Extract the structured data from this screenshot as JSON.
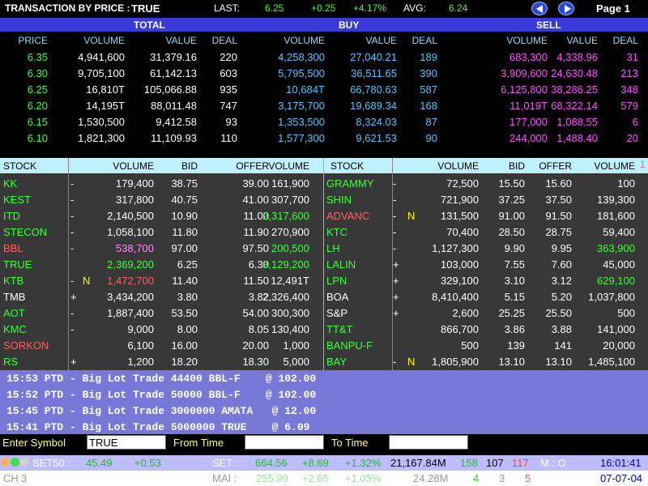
{
  "colors": {
    "green": "#3cff3c",
    "yellow": "#ffff00",
    "white": "#ffffff",
    "cyan": "#50c8ff",
    "magenta": "#ff50ff",
    "red": "#ff6060",
    "pink": "#ff88ff",
    "dimgreen": "#40ff40"
  },
  "top": {
    "title": "TRANSACTION BY PRICE :",
    "symbol": "TRUE",
    "last_label": "LAST:",
    "last": "6.25",
    "change": "+0.25",
    "pct": "+4.17%",
    "avg_label": "AVG:",
    "avg": "6.24",
    "page": "Page 1",
    "prev_icon": "arrow-left-icon",
    "next_icon": "arrow-right-icon"
  },
  "groups": {
    "total": "TOTAL",
    "buy": "BUY",
    "sell": "SELL"
  },
  "price_headers": [
    "PRICE",
    "VOLUME",
    "VALUE",
    "DEAL",
    "VOLUME",
    "VALUE",
    "DEAL",
    "VOLUME",
    "VALUE",
    "DEAL"
  ],
  "price_rows": [
    {
      "price": "6.35",
      "t_vol": "4,941,600",
      "t_val": "31,379.16",
      "t_deal": "220",
      "b_vol": "4,258,300",
      "b_val": "27,040.21",
      "b_deal": "189",
      "s_vol": "683,300",
      "s_val": "4,338.96",
      "s_deal": "31"
    },
    {
      "price": "6.30",
      "t_vol": "9,705,100",
      "t_val": "61,142.13",
      "t_deal": "603",
      "b_vol": "5,795,500",
      "b_val": "36,511.65",
      "b_deal": "390",
      "s_vol": "3,909,600",
      "s_val": "24,630.48",
      "s_deal": "213"
    },
    {
      "price": "6.25",
      "t_vol": "16,810T",
      "t_val": "105,066.88",
      "t_deal": "935",
      "b_vol": "10,684T",
      "b_val": "66,780.63",
      "b_deal": "587",
      "s_vol": "6,125,800",
      "s_val": "38,286.25",
      "s_deal": "348"
    },
    {
      "price": "6.20",
      "t_vol": "14,195T",
      "t_val": "88,011.48",
      "t_deal": "747",
      "b_vol": "3,175,700",
      "b_val": "19,689.34",
      "b_deal": "168",
      "s_vol": "11,019T",
      "s_val": "68,322.14",
      "s_deal": "579"
    },
    {
      "price": "6.15",
      "t_vol": "1,530,500",
      "t_val": "9,412.58",
      "t_deal": "93",
      "b_vol": "1,353,500",
      "b_val": "8,324.03",
      "b_deal": "87",
      "s_vol": "177,000",
      "s_val": "1,088.55",
      "s_deal": "6"
    },
    {
      "price": "6.10",
      "t_vol": "1,821,300",
      "t_val": "11,109.93",
      "t_deal": "110",
      "b_vol": "1,577,300",
      "b_val": "9,621.53",
      "b_deal": "90",
      "s_vol": "244,000",
      "s_val": "1,488.40",
      "s_deal": "20"
    }
  ],
  "stock_headers": [
    "STOCK",
    "VOLUME",
    "BID",
    "OFFER",
    "VOLUME",
    "STOCK",
    "VOLUME",
    "BID",
    "OFFER",
    "VOLUME"
  ],
  "stock_marker": "1",
  "stocks_left": [
    {
      "sym": "KK",
      "sym_color": "green",
      "sign": "-",
      "flag": "",
      "vol": "179,400",
      "vol_color": "white",
      "bid": "38.75",
      "offer": "39.00",
      "ovol": "161,900",
      "ovol_color": "white"
    },
    {
      "sym": "KEST",
      "sym_color": "green",
      "sign": "-",
      "flag": "",
      "vol": "317,800",
      "vol_color": "white",
      "bid": "40.75",
      "offer": "41.00",
      "ovol": "307,700",
      "ovol_color": "white"
    },
    {
      "sym": "ITD",
      "sym_color": "green",
      "sign": "-",
      "flag": "",
      "vol": "2,140,500",
      "vol_color": "white",
      "bid": "10.90",
      "offer": "11.00",
      "ovol": "2,317,600",
      "ovol_color": "green"
    },
    {
      "sym": "STECON",
      "sym_color": "green",
      "sign": "-",
      "flag": "",
      "vol": "1,058,100",
      "vol_color": "white",
      "bid": "11.80",
      "offer": "11.90",
      "ovol": "270,900",
      "ovol_color": "white"
    },
    {
      "sym": "BBL",
      "sym_color": "red",
      "sign": "-",
      "flag": "",
      "vol": "538,700",
      "vol_color": "pink",
      "bid": "97.00",
      "offer": "97.50",
      "ovol": "200,500",
      "ovol_color": "green"
    },
    {
      "sym": "TRUE",
      "sym_color": "green",
      "sign": "",
      "flag": "",
      "vol": "2,369,200",
      "vol_color": "green",
      "bid": "6.25",
      "offer": "6.30",
      "ovol": "3,129,200",
      "ovol_color": "green"
    },
    {
      "sym": "KTB",
      "sym_color": "green",
      "sign": "-",
      "flag": "N",
      "vol": "1,472,700",
      "vol_color": "red",
      "bid": "11.40",
      "offer": "11.50",
      "ovol": "12,491T",
      "ovol_color": "white"
    },
    {
      "sym": "TMB",
      "sym_color": "white",
      "sign": "+",
      "flag": "",
      "vol": "3,434,200",
      "vol_color": "white",
      "bid": "3.80",
      "offer": "3.82",
      "ovol": "2,326,400",
      "ovol_color": "white"
    },
    {
      "sym": "AOT",
      "sym_color": "green",
      "sign": "-",
      "flag": "",
      "vol": "1,887,400",
      "vol_color": "white",
      "bid": "53.50",
      "offer": "54.00",
      "ovol": "300,300",
      "ovol_color": "white"
    },
    {
      "sym": "KMC",
      "sym_color": "green",
      "sign": "-",
      "flag": "",
      "vol": "9,000",
      "vol_color": "white",
      "bid": "8.00",
      "offer": "8.05",
      "ovol": "130,400",
      "ovol_color": "white"
    },
    {
      "sym": "SORKON",
      "sym_color": "red",
      "sign": "",
      "flag": "",
      "vol": "6,100",
      "vol_color": "white",
      "bid": "16.00",
      "offer": "20.00",
      "ovol": "1,000",
      "ovol_color": "white"
    },
    {
      "sym": "RS",
      "sym_color": "green",
      "sign": "+",
      "flag": "",
      "vol": "1,200",
      "vol_color": "white",
      "bid": "18.20",
      "offer": "18.30",
      "ovol": "5,000",
      "ovol_color": "white"
    }
  ],
  "stocks_right": [
    {
      "sym": "GRAMMY",
      "sym_color": "green",
      "sign": "-",
      "flag": "",
      "vol": "72,500",
      "vol_color": "white",
      "bid": "15.50",
      "offer": "15.60",
      "ovol": "100",
      "ovol_color": "white"
    },
    {
      "sym": "SHIN",
      "sym_color": "green",
      "sign": "-",
      "flag": "",
      "vol": "721,900",
      "vol_color": "white",
      "bid": "37.25",
      "offer": "37.50",
      "ovol": "139,300",
      "ovol_color": "white"
    },
    {
      "sym": "ADVANC",
      "sym_color": "red",
      "sign": "-",
      "flag": "N",
      "vol": "131,500",
      "vol_color": "white",
      "bid": "91.00",
      "offer": "91.50",
      "ovol": "181,600",
      "ovol_color": "white"
    },
    {
      "sym": "KTC",
      "sym_color": "green",
      "sign": "-",
      "flag": "",
      "vol": "70,400",
      "vol_color": "white",
      "bid": "28.50",
      "offer": "28.75",
      "ovol": "59,400",
      "ovol_color": "white"
    },
    {
      "sym": "LH",
      "sym_color": "green",
      "sign": "-",
      "flag": "",
      "vol": "1,127,300",
      "vol_color": "white",
      "bid": "9.90",
      "offer": "9.95",
      "ovol": "363,900",
      "ovol_color": "green"
    },
    {
      "sym": "LALIN",
      "sym_color": "green",
      "sign": "+",
      "flag": "",
      "vol": "103,000",
      "vol_color": "white",
      "bid": "7.55",
      "offer": "7.60",
      "ovol": "45,000",
      "ovol_color": "white"
    },
    {
      "sym": "LPN",
      "sym_color": "green",
      "sign": "+",
      "flag": "",
      "vol": "329,100",
      "vol_color": "white",
      "bid": "3.10",
      "offer": "3.12",
      "ovol": "629,100",
      "ovol_color": "green"
    },
    {
      "sym": "BOA",
      "sym_color": "white",
      "sign": "+",
      "flag": "",
      "vol": "8,410,400",
      "vol_color": "white",
      "bid": "5.15",
      "offer": "5.20",
      "ovol": "1,037,800",
      "ovol_color": "white"
    },
    {
      "sym": "S&P",
      "sym_color": "white",
      "sign": "+",
      "flag": "",
      "vol": "2,600",
      "vol_color": "white",
      "bid": "25.25",
      "offer": "25.50",
      "ovol": "500",
      "ovol_color": "white"
    },
    {
      "sym": "TT&T",
      "sym_color": "green",
      "sign": "",
      "flag": "",
      "vol": "866,700",
      "vol_color": "white",
      "bid": "3.86",
      "offer": "3.88",
      "ovol": "141,000",
      "ovol_color": "white"
    },
    {
      "sym": "BANPU-F",
      "sym_color": "green",
      "sign": "",
      "flag": "",
      "vol": "500",
      "vol_color": "white",
      "bid": "139",
      "offer": "141",
      "ovol": "20,000",
      "ovol_color": "white"
    },
    {
      "sym": "BAY",
      "sym_color": "green",
      "sign": "-",
      "flag": "N",
      "vol": "1,805,900",
      "vol_color": "white",
      "bid": "13.10",
      "offer": "13.10",
      "ovol": "1,485,100",
      "ovol_color": "white"
    }
  ],
  "biglot": [
    "15:53 PTD - Big Lot Trade 44400 BBL-F    @ 102.00",
    "15:52 PTD - Big Lot Trade 50000 BBL-F    @ 102.00",
    "15:45 PTD - Big Lot Trade 3000000 AMATA   @ 12.00",
    "15:41 PTD - Big Lot Trade 5000000 TRUE    @ 6.09"
  ],
  "search": {
    "symbol_label": "Enter Symbol",
    "symbol_value": "TRUE",
    "from_label": "From Time",
    "from_value": "",
    "to_label": "To Time",
    "to_value": ""
  },
  "index1": {
    "set50_label": "SET50 :",
    "set50": "45.49",
    "set50_chg": "+0.53",
    "set_label": "SET :",
    "set": "664.56",
    "set_chg": "+8.69",
    "set_pct": "+1.32%",
    "set_value": "21,167.84M",
    "up": "158",
    "unch": "107",
    "down": "117",
    "mode": "M : O",
    "time": "16:01:41"
  },
  "index2": {
    "ch_label": "CH",
    "ch": "3",
    "mai_label": "MAI :",
    "mai": "255.99",
    "mai_chg": "+2.65",
    "mai_pct": "+1.05%",
    "mai_value": "24.28M",
    "up": "4",
    "unch": "3",
    "down": "5",
    "date": "07-07-04"
  }
}
